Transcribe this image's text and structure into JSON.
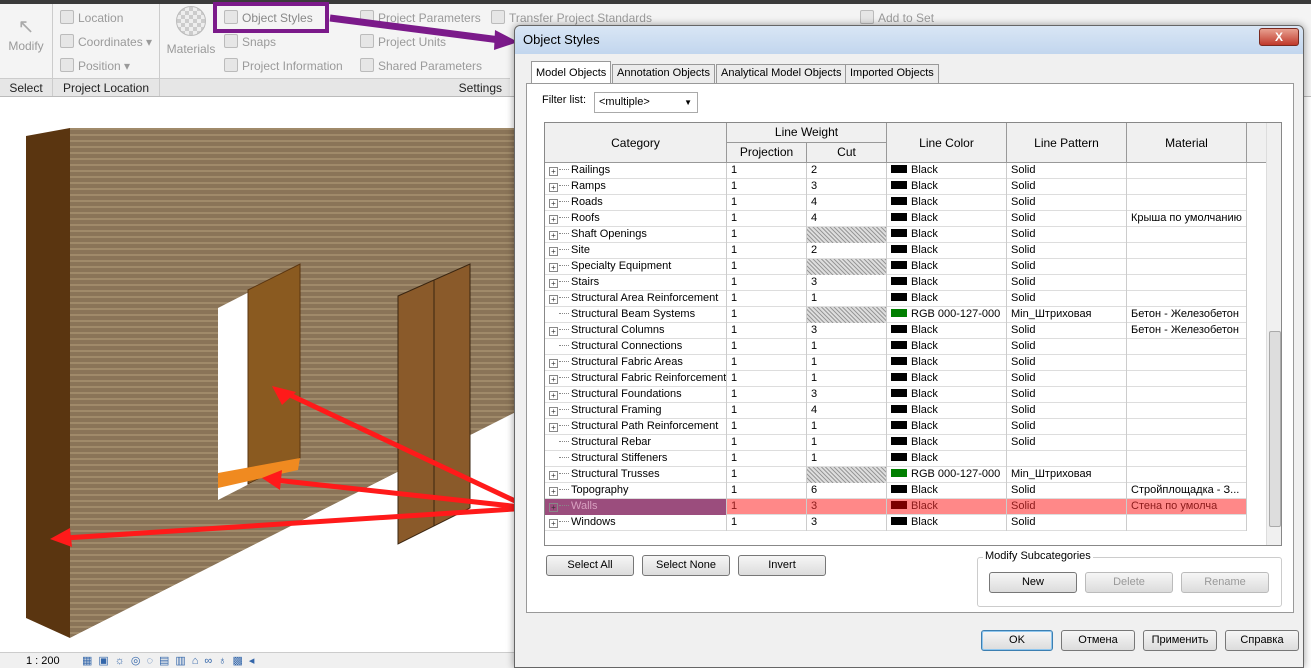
{
  "ribbon": {
    "select": {
      "modify": "Modify",
      "panel": "Select"
    },
    "project_location": {
      "items": [
        "Location",
        "Coordinates ▾",
        "Position ▾"
      ],
      "panel": "Project Location"
    },
    "settings": {
      "materials": "Materials",
      "col1": [
        "Object Styles",
        "Snaps",
        "Project Information"
      ],
      "col2": [
        "Project Parameters",
        "Project Units",
        "Shared Parameters"
      ],
      "transfer": "Transfer Project Standards",
      "panel": "Settings"
    },
    "add_to_set": "Add to Set"
  },
  "status_bar": {
    "scale": "1 : 200"
  },
  "dialog": {
    "title": "Object Styles",
    "close": "X",
    "tabs": [
      "Model Objects",
      "Annotation Objects",
      "Analytical Model Objects",
      "Imported Objects"
    ],
    "filter_label": "Filter list:",
    "filter_value": "<multiple>",
    "headers": {
      "category": "Category",
      "line_weight": "Line Weight",
      "projection": "Projection",
      "cut": "Cut",
      "line_color": "Line Color",
      "line_pattern": "Line Pattern",
      "material": "Material"
    },
    "rows": [
      {
        "name": "Railings",
        "exp": true,
        "proj": "1",
        "cut": "2",
        "color": "Black",
        "sw": "#000000",
        "pattern": "Solid",
        "material": ""
      },
      {
        "name": "Ramps",
        "exp": true,
        "proj": "1",
        "cut": "3",
        "color": "Black",
        "sw": "#000000",
        "pattern": "Solid",
        "material": ""
      },
      {
        "name": "Roads",
        "exp": true,
        "proj": "1",
        "cut": "4",
        "color": "Black",
        "sw": "#000000",
        "pattern": "Solid",
        "material": ""
      },
      {
        "name": "Roofs",
        "exp": true,
        "proj": "1",
        "cut": "4",
        "color": "Black",
        "sw": "#000000",
        "pattern": "Solid",
        "material": "Крыша по умолчанию"
      },
      {
        "name": "Shaft Openings",
        "exp": true,
        "proj": "1",
        "cut": "",
        "hatch": true,
        "color": "Black",
        "sw": "#000000",
        "pattern": "Solid",
        "material": ""
      },
      {
        "name": "Site",
        "exp": true,
        "proj": "1",
        "cut": "2",
        "color": "Black",
        "sw": "#000000",
        "pattern": "Solid",
        "material": ""
      },
      {
        "name": "Specialty Equipment",
        "exp": true,
        "proj": "1",
        "cut": "",
        "hatch": true,
        "color": "Black",
        "sw": "#000000",
        "pattern": "Solid",
        "material": ""
      },
      {
        "name": "Stairs",
        "exp": true,
        "proj": "1",
        "cut": "3",
        "color": "Black",
        "sw": "#000000",
        "pattern": "Solid",
        "material": ""
      },
      {
        "name": "Structural Area Reinforcement",
        "exp": true,
        "proj": "1",
        "cut": "1",
        "color": "Black",
        "sw": "#000000",
        "pattern": "Solid",
        "material": ""
      },
      {
        "name": "Structural Beam Systems",
        "exp": false,
        "proj": "1",
        "cut": "",
        "hatch": true,
        "color": "RGB 000-127-000",
        "sw": "#007f00",
        "pattern": "Min_Штриховая",
        "material": "Бетон - Железобетон"
      },
      {
        "name": "Structural Columns",
        "exp": true,
        "proj": "1",
        "cut": "3",
        "color": "Black",
        "sw": "#000000",
        "pattern": "Solid",
        "material": "Бетон - Железобетон"
      },
      {
        "name": "Structural Connections",
        "exp": false,
        "proj": "1",
        "cut": "1",
        "color": "Black",
        "sw": "#000000",
        "pattern": "Solid",
        "material": ""
      },
      {
        "name": "Structural Fabric Areas",
        "exp": true,
        "proj": "1",
        "cut": "1",
        "color": "Black",
        "sw": "#000000",
        "pattern": "Solid",
        "material": ""
      },
      {
        "name": "Structural Fabric Reinforcement",
        "exp": true,
        "proj": "1",
        "cut": "1",
        "color": "Black",
        "sw": "#000000",
        "pattern": "Solid",
        "material": ""
      },
      {
        "name": "Structural Foundations",
        "exp": true,
        "proj": "1",
        "cut": "3",
        "color": "Black",
        "sw": "#000000",
        "pattern": "Solid",
        "material": ""
      },
      {
        "name": "Structural Framing",
        "exp": true,
        "proj": "1",
        "cut": "4",
        "color": "Black",
        "sw": "#000000",
        "pattern": "Solid",
        "material": ""
      },
      {
        "name": "Structural Path Reinforcement",
        "exp": true,
        "proj": "1",
        "cut": "1",
        "color": "Black",
        "sw": "#000000",
        "pattern": "Solid",
        "material": ""
      },
      {
        "name": "Structural Rebar",
        "exp": false,
        "proj": "1",
        "cut": "1",
        "color": "Black",
        "sw": "#000000",
        "pattern": "Solid",
        "material": ""
      },
      {
        "name": "Structural Stiffeners",
        "exp": false,
        "proj": "1",
        "cut": "1",
        "color": "Black",
        "sw": "#000000",
        "pattern": "",
        "material": ""
      },
      {
        "name": "Structural Trusses",
        "exp": true,
        "proj": "1",
        "cut": "",
        "hatch": true,
        "color": "RGB 000-127-000",
        "sw": "#007f00",
        "pattern": "Min_Штриховая",
        "material": ""
      },
      {
        "name": "Topography",
        "exp": true,
        "proj": "1",
        "cut": "6",
        "color": "Black",
        "sw": "#000000",
        "pattern": "Solid",
        "material": "Стройплощадка - З..."
      },
      {
        "name": "Walls",
        "exp": true,
        "proj": "1",
        "cut": "3",
        "color": "Black",
        "sw": "#7a0000",
        "pattern": "Solid",
        "material": "Стена по умолча",
        "selected": true
      },
      {
        "name": "Windows",
        "exp": true,
        "proj": "1",
        "cut": "3",
        "color": "Black",
        "sw": "#000000",
        "pattern": "Solid",
        "material": ""
      }
    ],
    "buttons": {
      "select_all": "Select All",
      "select_none": "Select None",
      "invert": "Invert"
    },
    "modify_subcategories": {
      "label": "Modify Subcategories",
      "new": "New",
      "delete": "Delete",
      "rename": "Rename"
    },
    "footer": {
      "ok": "OK",
      "cancel": "Отмена",
      "apply": "Применить",
      "help": "Справка"
    }
  },
  "colors": {
    "highlight_box": "#7b1a8a",
    "arrow": "#ff1a1a",
    "selected_row": "#ff8888"
  }
}
